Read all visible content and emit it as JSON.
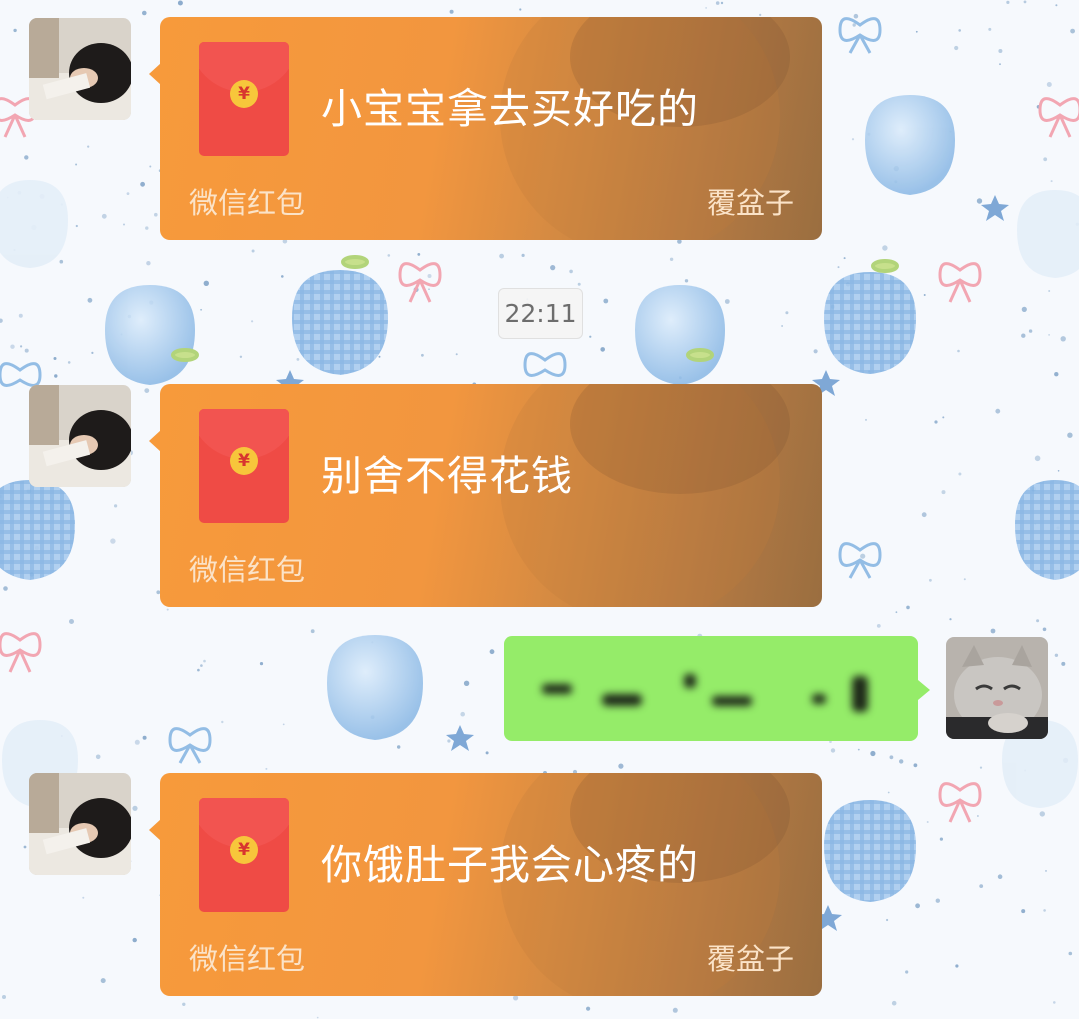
{
  "chat": {
    "messages": [
      {
        "type": "red_packet",
        "from": "other",
        "text": "小宝宝拿去买好吃的",
        "label": "微信红包",
        "sender": "覆盆子"
      },
      {
        "type": "timestamp",
        "text": "22:11"
      },
      {
        "type": "red_packet",
        "from": "other",
        "text": "别舍不得花钱",
        "label": "微信红包",
        "sender": ""
      },
      {
        "type": "text",
        "from": "me",
        "text": ""
      },
      {
        "type": "red_packet",
        "from": "other",
        "text": "你饿肚子我会心疼的",
        "label": "微信红包",
        "sender": "覆盆子"
      }
    ]
  },
  "red_packet_icon": {
    "symbol": "¥",
    "envelope_color": "#ef4b45",
    "coin_color": "#f7c63b"
  },
  "colors": {
    "packet_orange": "#f79a3b",
    "my_bubble_green": "#95ec69",
    "timestamp_text": "#6d6d6d"
  },
  "icons": [
    "avatar-girl",
    "avatar-cat",
    "red-envelope-icon",
    "yuan-coin-icon"
  ]
}
